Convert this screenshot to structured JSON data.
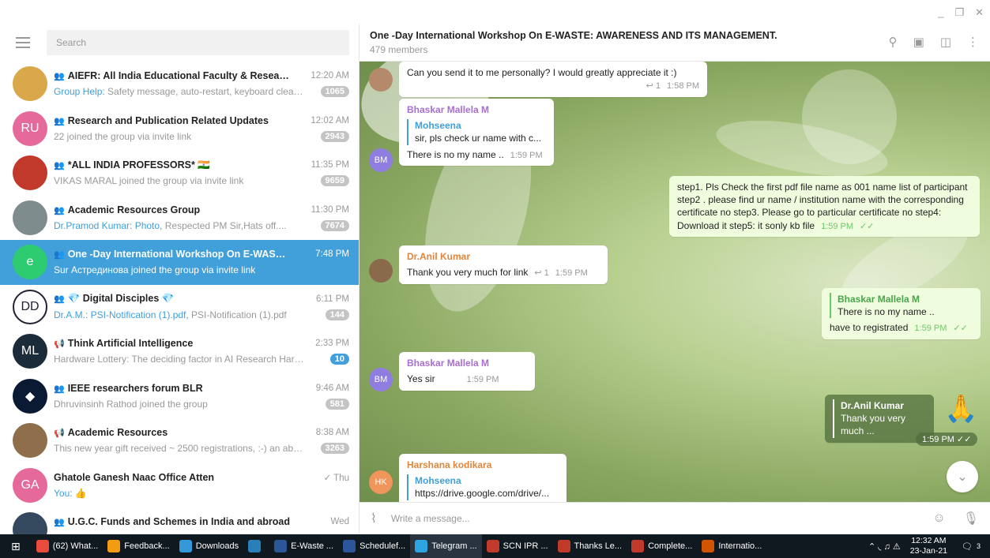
{
  "window": {
    "minimize": "_",
    "restore": "❐",
    "close": "✕"
  },
  "search": {
    "placeholder": "Search"
  },
  "chats": [
    {
      "name": "AIEFR: All India Educational Faculty & Research Up...",
      "time": "12:20 AM",
      "sender": "Group Help:",
      "preview": " Safety message, auto-restart, keyboard cleanin...",
      "badge": "1065",
      "avatar_color": "#d9a84a",
      "avatar_text": "",
      "icon": "group-icon"
    },
    {
      "name": "Research and Publication Related Updates",
      "time": "12:02 AM",
      "sender": "",
      "preview": "22 joined the group via invite link",
      "badge": "2943",
      "avatar_color": "#e5699a",
      "avatar_text": "RU",
      "icon": "group-icon"
    },
    {
      "name": "*ALL INDIA PROFESSORS* 🇮🇳",
      "time": "11:35 PM",
      "sender": "",
      "preview": "VIKAS MARAL joined the group via invite link",
      "badge": "9659",
      "avatar_color": "#c0392b",
      "avatar_text": "",
      "icon": "group-icon"
    },
    {
      "name": "Academic Resources Group",
      "time": "11:30 PM",
      "sender": "Dr.Pramod Kumar: Photo,",
      "preview": " Respected PM Sir,Hats off....",
      "badge": "7674",
      "avatar_color": "#7f8c8d",
      "avatar_text": "",
      "icon": "group-icon"
    },
    {
      "name": "One -Day International Workshop On E-WASTE: AWA...",
      "time": "7:48 PM",
      "sender": "",
      "preview": "Sur Астрединова joined the group via invite link",
      "badge": "",
      "avatar_color": "#2ecc71",
      "avatar_text": "e",
      "icon": "group-icon"
    },
    {
      "name": "💎 Digital Disciples 💎",
      "time": "6:11 PM",
      "sender": "Dr.A.M.: PSI-Notification (1).pdf,",
      "preview": " PSI-Notification (1).pdf",
      "badge": "144",
      "avatar_color": "#ffffff",
      "avatar_text": "DD",
      "icon": "group-icon"
    },
    {
      "name": "Think Artificial Intelligence",
      "time": "2:33 PM",
      "sender": "",
      "preview": "Hardware Lottery: The deciding factor in AI Research Hardwar...",
      "badge": "10",
      "badge_blue": true,
      "avatar_color": "#1c2b3a",
      "avatar_text": "ML",
      "icon": "channel-icon"
    },
    {
      "name": "IEEE researchers forum BLR",
      "time": "9:46 AM",
      "sender": "",
      "preview": "Dhruvinsinh Rathod joined the group",
      "badge": "581",
      "avatar_color": "#0b1a33",
      "avatar_text": "◆",
      "icon": "group-icon"
    },
    {
      "name": "Academic Resources",
      "time": "8:38 AM",
      "sender": "",
      "preview": "This new year gift received ~ 2500 registrations, :-) an absolut...",
      "badge": "3263",
      "avatar_color": "#8e6e4b",
      "avatar_text": "",
      "icon": "channel-icon"
    },
    {
      "name": "Ghatole Ganesh Naac Office Atten",
      "time": "✓ Thu",
      "sender": "You:",
      "preview": " 👍",
      "badge": "",
      "avatar_color": "#e5699a",
      "avatar_text": "GA",
      "icon": ""
    },
    {
      "name": "U.G.C. Funds and Schemes in India and abroad",
      "time": "Wed",
      "sender": "",
      "preview": "",
      "badge": "",
      "avatar_color": "#34495e",
      "avatar_text": "",
      "icon": "group-icon"
    }
  ],
  "header": {
    "title": "One -Day International Workshop On E-WASTE: AWARENESS AND ITS MANAGEMENT.",
    "members": "479 members"
  },
  "messages": {
    "m1": {
      "text": "Can you send it to me personally? I would greatly appreciate it :)",
      "reply": "↩ 1",
      "time": "1:58 PM"
    },
    "m2": {
      "sender": "Bhaskar Mallela M",
      "quote_name": "Mohseena",
      "quote_text": "sir, pls check ur name with c...",
      "text": "There is no my name ..",
      "time": "1:59 PM",
      "avatar": "BM"
    },
    "m3": {
      "text": "step1. Pls Check the first pdf file name as 001 name list of participant  step2 . please find ur name / institution name with the corresponding certificate no  step3. Please go to particular certificate no  step4: Download it  step5: it sonly kb file",
      "time": "1:59 PM"
    },
    "m4": {
      "sender": "Dr.Anil Kumar",
      "text": "Thank you very much for link",
      "reply": "↩ 1",
      "time": "1:59 PM"
    },
    "m5": {
      "quote_name": "Bhaskar Mallela M",
      "quote_text": "There is no my name ..",
      "text": "have to registrated",
      "time": "1:59 PM"
    },
    "m6": {
      "sender": "Bhaskar Mallela M",
      "text": "Yes sir",
      "time": "1:59 PM",
      "avatar": "BM"
    },
    "m7": {
      "quote_name": "Dr.Anil Kumar",
      "quote_text": "Thank you very much ...",
      "sticker": "🙏",
      "time": "1:59 PM"
    },
    "m8": {
      "sender": "Harshana kodikara",
      "quote_name": "Mohseena",
      "quote_text": "https://drive.google.com/drive/...",
      "avatar": "HK"
    }
  },
  "composer": {
    "placeholder": "Write a message..."
  },
  "taskbar": {
    "items": [
      {
        "label": "(62) What...",
        "color": "#e74c3c"
      },
      {
        "label": "Feedback...",
        "color": "#f39c12"
      },
      {
        "label": "Downloads",
        "color": "#3498db"
      },
      {
        "label": "",
        "color": "#2980b9"
      },
      {
        "label": "E-Waste ...",
        "color": "#2b579a"
      },
      {
        "label": "Schedulef...",
        "color": "#2b579a"
      },
      {
        "label": "Telegram ...",
        "color": "#2ca5e0"
      },
      {
        "label": "SCN IPR ...",
        "color": "#c0392b"
      },
      {
        "label": "Thanks Le...",
        "color": "#c0392b"
      },
      {
        "label": "Complete...",
        "color": "#c0392b"
      },
      {
        "label": "Internatio...",
        "color": "#d35400"
      }
    ],
    "time": "12:32 AM",
    "date": "23-Jan-21",
    "notif": "3"
  }
}
